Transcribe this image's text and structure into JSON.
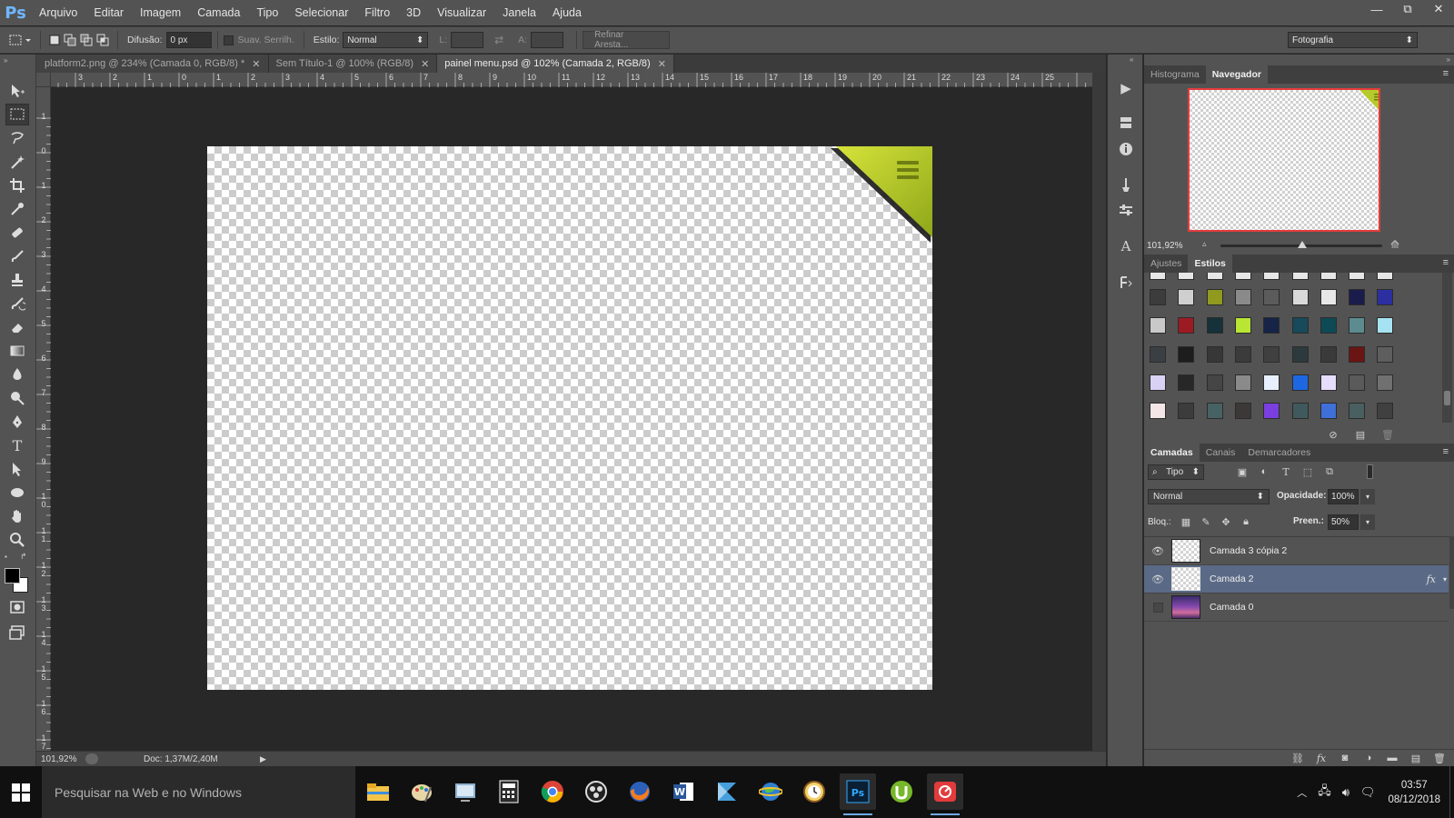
{
  "app": {
    "logo": "Ps",
    "accent": "#6fb6ff"
  },
  "menu": [
    "Arquivo",
    "Editar",
    "Imagem",
    "Camada",
    "Tipo",
    "Selecionar",
    "Filtro",
    "3D",
    "Visualizar",
    "Janela",
    "Ajuda"
  ],
  "window_controls": {
    "minimize": "—",
    "restore": "⧉",
    "close": "✕"
  },
  "options": {
    "feather_label": "Difusão:",
    "feather_value": "0 px",
    "antialias_label": "Suav. Serrilh.",
    "style_label": "Estilo:",
    "style_value": "Normal",
    "width_label": "L:",
    "height_label": "A:",
    "refine_label": "Refinar Aresta...",
    "workspace": "Fotografia"
  },
  "tabs": [
    {
      "label": "platform2.png @ 234% (Camada 0, RGB/8) *",
      "active": false
    },
    {
      "label": "Sem Título-1 @ 100% (RGB/8)",
      "active": false
    },
    {
      "label": "painel menu.psd @ 102% (Camada 2, RGB/8)",
      "active": true
    }
  ],
  "ruler": {
    "top_labels": [
      "4",
      "3",
      "2",
      "1",
      "0",
      "1",
      "2",
      "3",
      "4",
      "5",
      "6",
      "7",
      "8",
      "9",
      "10",
      "11",
      "12",
      "13",
      "14",
      "15",
      "16",
      "17",
      "18",
      "19",
      "20",
      "21",
      "22",
      "23",
      "24",
      "25"
    ],
    "left_labels": [
      "1",
      "0",
      "1",
      "2",
      "3",
      "4",
      "5",
      "6",
      "7",
      "8",
      "9",
      "10",
      "11",
      "12",
      "13",
      "14",
      "15",
      "16",
      "17"
    ]
  },
  "status": {
    "zoom": "101,92%",
    "doc": "Doc: 1,37M/2,40M"
  },
  "navigator": {
    "tabs": [
      "Histograma",
      "Navegador"
    ],
    "zoom": "101,92%"
  },
  "styles_panel": {
    "tabs": [
      "Ajustes",
      "Estilos"
    ],
    "swatch_colors": [
      "#3c3c3c",
      "#cfcfcf",
      "#8f9a1e",
      "#8a8a8a",
      "#5b5b5b",
      "#d9d9d9",
      "#e7e7e7",
      "#1a1d4b",
      "#2b2fa0",
      "#c9c9c9",
      "#9c1b23",
      "#153139",
      "#b9e534",
      "#152447",
      "#174a5a",
      "#0d4a55",
      "#5c8c90",
      "#a6e3f2",
      "#3a3f43",
      "#1d1d1d",
      "#373737",
      "#3b3b3b",
      "#404040",
      "#2d3a3d",
      "#3a3a3a",
      "#6a1414",
      "#5e5e5e",
      "#d9d2f4",
      "#272727",
      "#454545",
      "#8a8a8a",
      "#e8f0ff",
      "#1d68e2",
      "#e6defc",
      "#5a5a5a",
      "#707070",
      "#f4e6e6",
      "#3c3c3c",
      "#476262",
      "#3d3838",
      "#7a3fe0",
      "#40595c",
      "#3f6fd8",
      "#4a5f5f",
      "#404040"
    ]
  },
  "layers_panel": {
    "tabs": [
      "Camadas",
      "Canais",
      "Demarcadores"
    ],
    "filter": "Tipo",
    "blend_mode": "Normal",
    "opacity_label": "Opacidade:",
    "opacity": "100%",
    "lock_label": "Bloq.:",
    "fill_label": "Preen.:",
    "fill": "50%",
    "layers": [
      {
        "name": "Camada 3 cópia 2",
        "visible": true,
        "selected": false,
        "fx": ""
      },
      {
        "name": "Camada 2",
        "visible": true,
        "selected": true,
        "fx": "fx"
      },
      {
        "name": "Camada 0",
        "visible": false,
        "selected": false,
        "fx": ""
      }
    ]
  },
  "taskbar": {
    "search_placeholder": "Pesquisar na Web e no Windows",
    "time": "03:57",
    "date": "08/12/2018"
  }
}
